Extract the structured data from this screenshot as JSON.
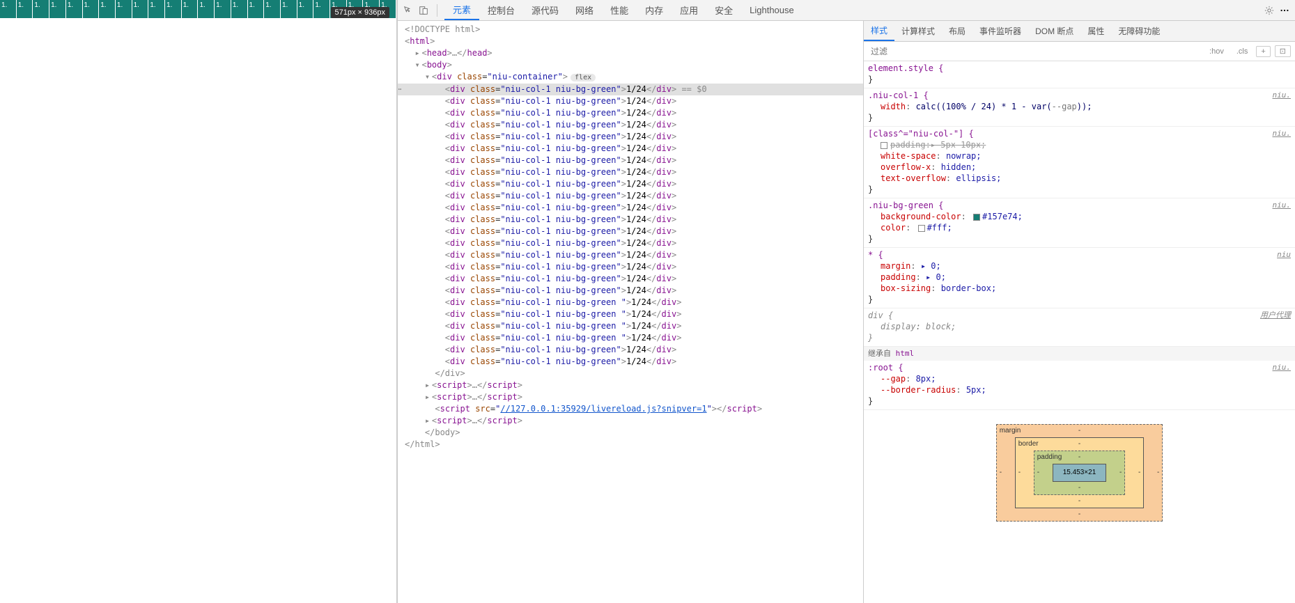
{
  "preview": {
    "dim_label": "571px × 936px",
    "col_text": "1.",
    "col_count": 24
  },
  "toolbar": {
    "tabs": [
      "元素",
      "控制台",
      "源代码",
      "网络",
      "性能",
      "内存",
      "应用",
      "安全",
      "Lighthouse"
    ],
    "active": 0
  },
  "dom": {
    "doctype": "<!DOCTYPE html>",
    "html_open": "html",
    "head": "head",
    "body": "body",
    "container_class": "niu-container",
    "container_badge": "flex",
    "row_class": "niu-col-1 niu-bg-green",
    "row_class_sp": "niu-col-1 niu-bg-green ",
    "row_text": "1/24",
    "suffix": " == $0",
    "script_src": "//127.0.0.1:35929/livereload.js?snipver=1",
    "script": "script",
    "div": "div",
    "close_div": "</div>",
    "close_body": "</body>",
    "close_html": "</html>"
  },
  "sidebar": {
    "tabs": [
      "样式",
      "计算样式",
      "布局",
      "事件监听器",
      "DOM 断点",
      "属性",
      "无障碍功能"
    ],
    "active": 0,
    "filter_placeholder": "过滤",
    "chips": [
      ":hov",
      ".cls",
      "+"
    ],
    "last_icon": "⊡"
  },
  "rules": {
    "element_style": {
      "selector": "element.style {",
      "close": "}"
    },
    "r1": {
      "selector": ".niu-col-1 {",
      "src": "niu.",
      "p1_name": "width",
      "p1_val": "calc((100% / 24) * 1 - var(",
      "p1_var": "--gap",
      "p1_tail": "));",
      "close": "}"
    },
    "r2": {
      "selector": "[class^=\"niu-col-\"] {",
      "src": "niu.",
      "pad_strike": "padding:▸ 5px 10px;",
      "p1_name": "white-space",
      "p1_val": "nowrap;",
      "p2_name": "overflow-x",
      "p2_val": "hidden;",
      "p3_name": "text-overflow",
      "p3_val": "ellipsis;",
      "close": "}"
    },
    "r3": {
      "selector": ".niu-bg-green {",
      "src": "niu.",
      "p1_name": "background-color",
      "p1_val": "#157e74;",
      "p1_sw": "#157e74",
      "p2_name": "color",
      "p2_val": "#fff;",
      "p2_sw": "#ffffff",
      "close": "}"
    },
    "r4": {
      "selector": "* {",
      "src": "niu",
      "p1_name": "margin",
      "p1_val": "▸ 0;",
      "p2_name": "padding",
      "p2_val": "▸ 0;",
      "p3_name": "box-sizing",
      "p3_val": "border-box;",
      "close": "}"
    },
    "r5": {
      "selector": "div {",
      "src": "用户代理",
      "p1_name": "display",
      "p1_val": "block;",
      "close": "}"
    },
    "inherit": "继承自 ",
    "inherit_el": "html",
    "r6": {
      "selector": ":root {",
      "src": "niu.",
      "p1_name": "--gap",
      "p1_val": "8px;",
      "p2_name": "--border-radius",
      "p2_val": "5px;",
      "close": "}"
    }
  },
  "box": {
    "margin": "margin",
    "border": "border",
    "padding": "padding",
    "content": "15.453×21",
    "dash": "-"
  }
}
